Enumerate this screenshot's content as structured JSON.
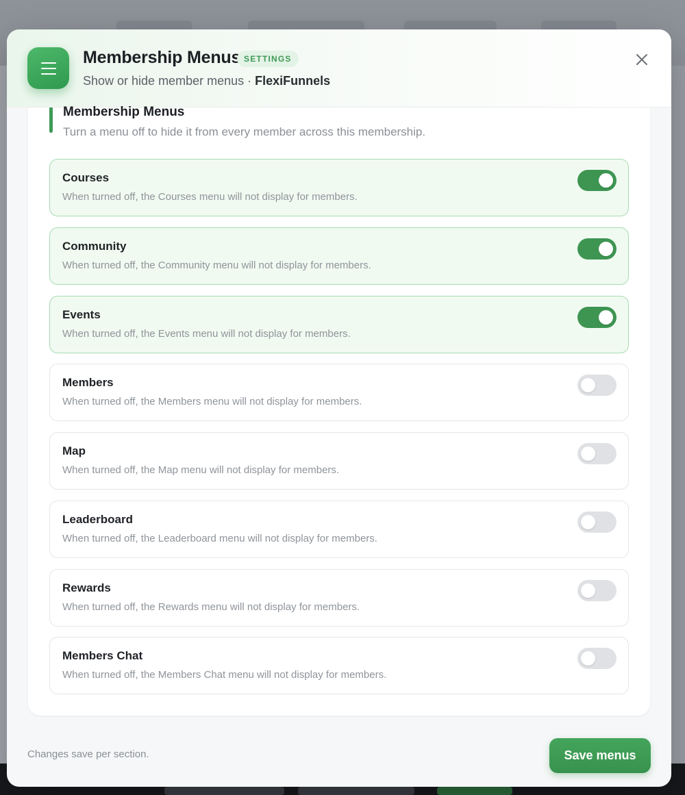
{
  "header": {
    "title": "Membership Menus",
    "badge": "SETTINGS",
    "subtitle_prefix": "Show or hide member menus · ",
    "subtitle_brand": "FlexiFunnels",
    "icon": "menu-icon",
    "close_icon": "close-icon"
  },
  "section": {
    "title": "Membership Menus",
    "description": "Turn a menu off to hide it from every member across this membership."
  },
  "menus": [
    {
      "name": "Courses",
      "description": "When turned off, the Courses menu will not display for members.",
      "enabled": true
    },
    {
      "name": "Community",
      "description": "When turned off, the Community menu will not display for members.",
      "enabled": true
    },
    {
      "name": "Events",
      "description": "When turned off, the Events menu will not display for members.",
      "enabled": true
    },
    {
      "name": "Members",
      "description": "When turned off, the Members menu will not display for members.",
      "enabled": false
    },
    {
      "name": "Map",
      "description": "When turned off, the Map menu will not display for members.",
      "enabled": false
    },
    {
      "name": "Leaderboard",
      "description": "When turned off, the Leaderboard menu will not display for members.",
      "enabled": false
    },
    {
      "name": "Rewards",
      "description": "When turned off, the Rewards menu will not display for members.",
      "enabled": false
    },
    {
      "name": "Members Chat",
      "description": "When turned off, the Members Chat menu will not display for members.",
      "enabled": false
    }
  ],
  "footer": {
    "note": "Changes save per section.",
    "save_label": "Save menus"
  },
  "colors": {
    "accent": "#3e9552",
    "toggle_off": "#dfe1e4",
    "active_row_bg": "#f0faf1",
    "active_row_border": "#a9dbb2"
  }
}
